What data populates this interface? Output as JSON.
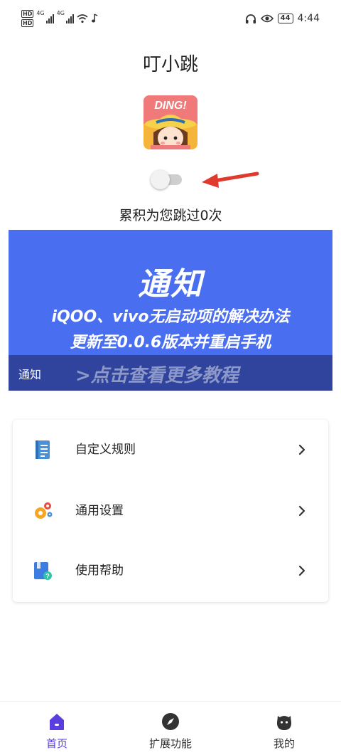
{
  "status_bar": {
    "hd_top": "HD",
    "hd_bottom": "HD",
    "network_1": "4G",
    "network_2": "4G",
    "battery": "44",
    "time": "4:44"
  },
  "app": {
    "title": "叮小跳",
    "avatar_text": "DING!",
    "toggle_on": false,
    "skip_count_text": "累积为您跳过0次"
  },
  "banner": {
    "title": "通知",
    "line1": "iQOO、vivo无启动项的解决办法",
    "line2": "更新至0.0.6版本并重启手机",
    "tag": "通知",
    "more": ">点击查看更多教程"
  },
  "menu": {
    "items": [
      {
        "label": "自定义规则",
        "icon": "document-list-icon"
      },
      {
        "label": "通用设置",
        "icon": "gears-icon"
      },
      {
        "label": "使用帮助",
        "icon": "help-book-icon"
      }
    ]
  },
  "bottom_nav": {
    "items": [
      {
        "label": "首页",
        "icon": "home-icon",
        "active": true
      },
      {
        "label": "扩展功能",
        "icon": "compass-icon",
        "active": false
      },
      {
        "label": "我的",
        "icon": "profile-face-icon",
        "active": false
      }
    ]
  },
  "colors": {
    "banner_blue": "#4a6ef0",
    "banner_footer": "#31449d",
    "accent_purple": "#5b3ee0",
    "arrow_red": "#e03a2e"
  }
}
